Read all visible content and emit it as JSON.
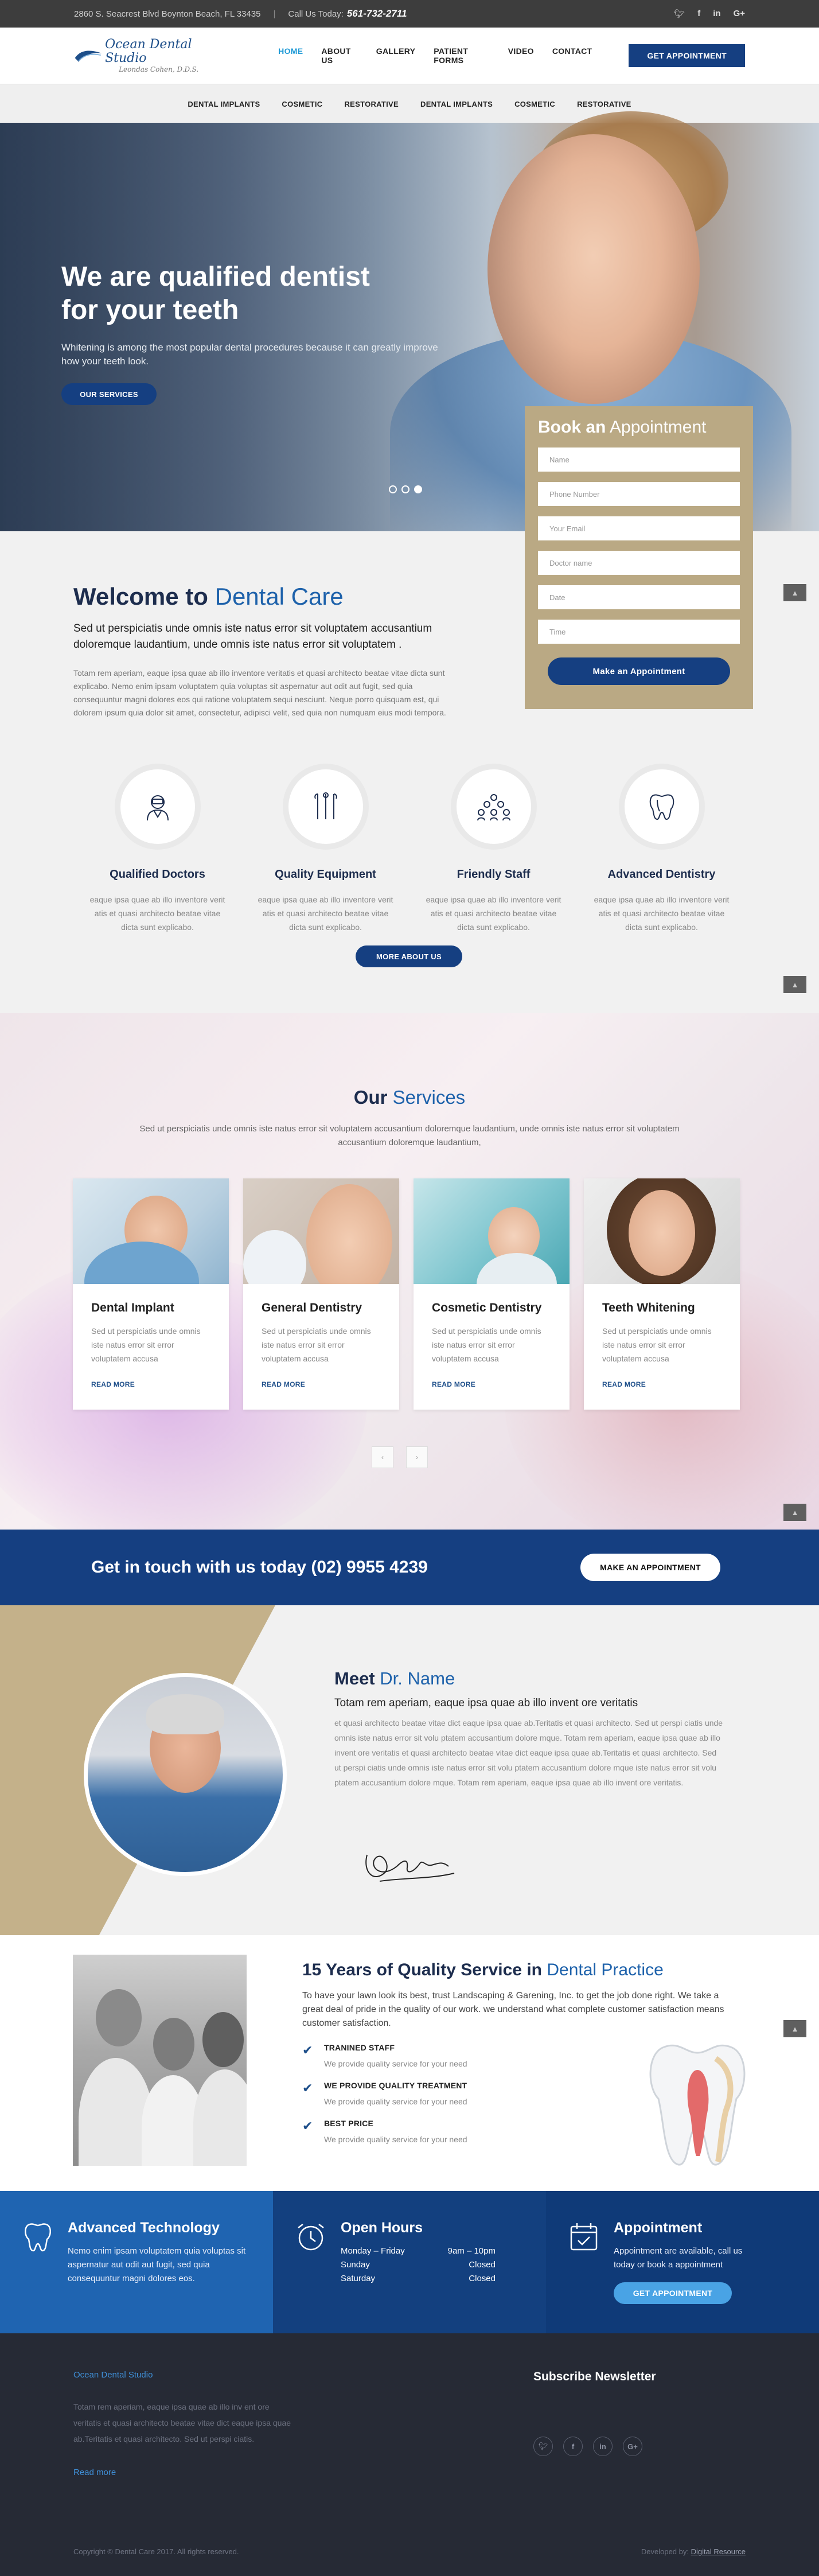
{
  "topbar": {
    "address": "2860 S. Seacrest Blvd Boynton Beach, FL 33435",
    "call_label": "Call Us Today:",
    "phone": "561-732-2711",
    "social": [
      "twitter-icon",
      "facebook-icon",
      "linkedin-icon",
      "googleplus-icon"
    ]
  },
  "header": {
    "logo_name": "Ocean Dental Studio",
    "logo_sub": "Leondas Cohen, D.D.S.",
    "nav": [
      "HOME",
      "ABOUT US",
      "GALLERY",
      "PATIENT FORMS",
      "VIDEO",
      "CONTACT"
    ],
    "appt_button": "GET APPOINTMENT"
  },
  "subnav": [
    "DENTAL IMPLANTS",
    "COSMETIC",
    "RESTORATIVE",
    "DENTAL IMPLANTS",
    "COSMETIC",
    "RESTORATIVE"
  ],
  "hero": {
    "title_line1": "We are qualified dentist",
    "title_line2": "for your teeth",
    "subtitle": "Whitening is among the most popular dental procedures because it can greatly improve how your teeth look.",
    "button": "OUR SERVICES",
    "slides_total": 3,
    "slide_active": 3
  },
  "booking": {
    "title_bold": "Book an",
    "title_rest": "Appointment",
    "placeholders": [
      "Name",
      "Phone Number",
      "Your Email",
      "Doctor name",
      "Date",
      "Time"
    ],
    "button": "Make an Appointment"
  },
  "welcome": {
    "title_bold": "Welcome to",
    "title_rest": "Dental Care",
    "lead": "Sed ut perspiciatis unde omnis iste natus error sit voluptatem accusantium doloremque laudantium, unde omnis iste natus error sit voluptatem .",
    "body": "Totam rem aperiam, eaque ipsa quae ab illo inventore veritatis et quasi architecto beatae vitae dicta sunt explicabo. Nemo enim ipsam voluptatem quia voluptas sit aspernatur aut odit aut fugit, sed quia consequuntur magni dolores eos qui ratione voluptatem sequi nesciunt. Neque porro quisquam est, qui dolorem ipsum quia dolor sit amet, consectetur, adipisci velit, sed quia non numquam eius modi tempora.",
    "features": [
      {
        "icon": "doctor-icon",
        "title": "Qualified Doctors",
        "text": "eaque ipsa quae ab illo inventore verit atis et quasi architecto beatae vitae dicta sunt explicabo."
      },
      {
        "icon": "dental-tools-icon",
        "title": "Quality Equipment",
        "text": "eaque ipsa quae ab illo inventore verit atis et quasi architecto beatae vitae dicta sunt explicabo."
      },
      {
        "icon": "staff-group-icon",
        "title": "Friendly Staff",
        "text": "eaque ipsa quae ab illo inventore verit atis et quasi architecto beatae vitae dicta sunt explicabo."
      },
      {
        "icon": "tooth-icon",
        "title": "Advanced Dentistry",
        "text": "eaque ipsa quae ab illo inventore verit atis et quasi architecto beatae vitae dicta sunt explicabo."
      }
    ],
    "more_button": "MORE ABOUT US"
  },
  "services": {
    "title_bold": "Our",
    "title_rest": "Services",
    "desc": "Sed ut perspiciatis unde omnis iste natus error sit voluptatem accusantium doloremque laudantium, unde omnis iste natus error sit voluptatem accusantium doloremque laudantium,",
    "cards": [
      {
        "title": "Dental Implant",
        "text": "Sed ut perspiciatis unde omnis iste natus error sit error voluptatem accusa",
        "link": "READ MORE"
      },
      {
        "title": "General Dentistry",
        "text": "Sed ut perspiciatis unde omnis iste natus error sit error voluptatem accusa",
        "link": "READ MORE"
      },
      {
        "title": "Cosmetic Dentistry",
        "text": "Sed ut perspiciatis unde omnis iste natus error sit error voluptatem accusa",
        "link": "READ MORE"
      },
      {
        "title": "Teeth Whitening",
        "text": "Sed ut perspiciatis unde omnis iste natus error sit error voluptatem accusa",
        "link": "READ MORE"
      }
    ],
    "prev": "‹",
    "next": "›"
  },
  "cta": {
    "text": "Get in touch with us today (02) 9955 4239",
    "button": "MAKE AN APPOINTMENT"
  },
  "doctor": {
    "title_bold": "Meet",
    "title_rest": "Dr. Name",
    "lead": "Totam rem aperiam, eaque ipsa quae ab illo invent ore veritatis",
    "body": "et quasi architecto beatae vitae dict eaque ipsa quae ab.Teritatis et quasi architecto. Sed ut perspi ciatis unde omnis iste natus error sit volu ptatem accusantium dolore mque. Totam rem aperiam, eaque ipsa quae ab illo invent ore veritatis et quasi architecto beatae vitae dict eaque ipsa quae ab.Teritatis et quasi architecto. Sed ut perspi ciatis unde omnis iste natus error sit volu ptatem accusantium dolore mque iste natus error sit volu ptatem accusantium dolore mque. Totam rem aperiam, eaque ipsa quae ab illo invent ore veritatis."
  },
  "quality": {
    "title_bold": "15 Years of Quality Service in",
    "title_rest": "Dental Practice",
    "lead": "To have your lawn look its best, trust Landscaping & Garening, Inc. to get the job done right. We take a great deal of pride in the quality of our work. we understand what complete customer satisfaction means customer satisfaction.",
    "items": [
      {
        "title": "TRANINED STAFF",
        "text": "We provide quality service for your need"
      },
      {
        "title": "WE PROVIDE QUALITY TREATMENT",
        "text": "We provide quality service for your need"
      },
      {
        "title": "BEST PRICE",
        "text": "We provide quality service for your need"
      }
    ]
  },
  "info": {
    "tech": {
      "title": "Advanced Technology",
      "text": "Nemo enim ipsam voluptatem quia voluptas sit aspernatur aut odit aut fugit, sed quia consequuntur magni dolores eos."
    },
    "hours": {
      "title": "Open Hours",
      "rows": [
        {
          "day": "Monday – Friday",
          "time": "9am – 10pm"
        },
        {
          "day": "Sunday",
          "time": "Closed"
        },
        {
          "day": "Saturday",
          "time": "Closed"
        }
      ]
    },
    "appt": {
      "title": "Appointment",
      "text": "Appointment are available, call us today or book a appointment",
      "button": "GET APPOINTMENT"
    },
    "colors": [
      "#1f64b1",
      "#13407f",
      "#0f3a78"
    ]
  },
  "footer": {
    "name": "Ocean Dental Studio",
    "about": "Totam rem aperiam, eaque ipsa quae ab illo inv ent ore veritatis et quasi architecto beatae vitae dict eaque ipsa quae ab.Teritatis et quasi architecto. Sed ut perspi ciatis.",
    "read_more": "Read more",
    "newsletter": "Subscribe Newsletter",
    "copyright": "Copyright © Dental Care 2017. All rights reserved.",
    "dev_label": "Developed by:",
    "dev_name": "Digital Resource"
  },
  "misc": {
    "side_up": "▲"
  }
}
